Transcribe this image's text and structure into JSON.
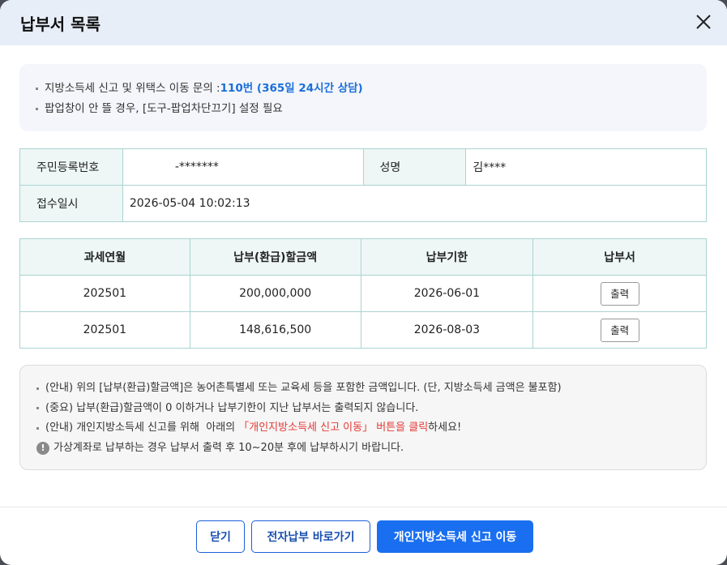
{
  "header": {
    "title": "납부서 목록",
    "close_icon": "close-icon"
  },
  "notice_top": {
    "line1_prefix": "지방소득세 신고 및 위택스 이동 문의 : ",
    "line1_highlight": "110번 (365일 24시간 상담)",
    "line2": "팝업창이 안 뜰 경우, [도구-팝업차단끄기] 설정 필요"
  },
  "info": {
    "rrn_label": "주민등록번호",
    "rrn_value": "-*******",
    "name_label": "성명",
    "name_value": "김****",
    "receipt_label": "접수일시",
    "receipt_value": "2026-05-04 10:02:13"
  },
  "list": {
    "headers": [
      "과세연월",
      "납부(환급)할금액",
      "납부기한",
      "납부서"
    ],
    "rows": [
      {
        "period": "202501",
        "amount": "200,000,000",
        "due": "2026-06-01",
        "action": "출력"
      },
      {
        "period": "202501",
        "amount": "148,616,500",
        "due": "2026-08-03",
        "action": "출력"
      }
    ]
  },
  "notice_bottom": {
    "line1": "(안내) 위의 [납부(환급)할금액]은 농어촌특별세 또는 교육세 등을 포함한 금액입니다. (단, 지방소득세 금액은 불포함)",
    "line2": "(중요) 납부(환급)할금액이 0 이하거나 납부기한이 지난 납부서는 출력되지 않습니다.",
    "line3_prefix": "(안내) 개인지방소득세 신고를 위해  아래의 ",
    "line3_highlight": "「개인지방소득세 신고 이동」 버튼을 클릭",
    "line3_suffix": "하세요!",
    "line4_icon": "!",
    "line4": "가상계좌로 납부하는 경우 납부서 출력 후 10~20분 후에 납부하시기 바랍니다."
  },
  "footer": {
    "close_label": "닫기",
    "epay_label": "전자납부 바로가기",
    "move_label": "개인지방소득세 신고 이동"
  },
  "colors": {
    "header_bg": "#e8eef8",
    "accent_blue": "#1b6fd8",
    "primary_button": "#1a6ff0",
    "table_border": "#a9d4d0",
    "table_header_bg": "#eef7f6",
    "highlight_red": "#e53935"
  }
}
